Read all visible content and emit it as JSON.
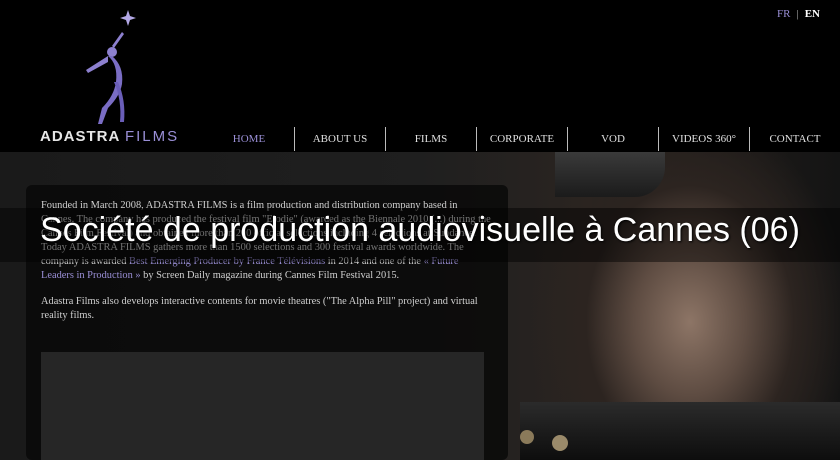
{
  "header": {
    "logo_primary": "ADASTRA",
    "logo_secondary": "FILMS",
    "lang_fr": "FR",
    "lang_separator": "|",
    "lang_en": "EN"
  },
  "nav": {
    "items": [
      "HOME",
      "ABOUT US",
      "FILMS",
      "CORPORATE",
      "VOD",
      "VIDEOS 360°",
      "CONTACT"
    ]
  },
  "content": {
    "para1_part1": "Founded in March 2008, ADASTRA FILMS is a film production and distribution company based in Cannes. The company has produced the festival film \"Elodie\" (awarded as the Biennale 2010 (...) during the Cannes Film Festival) and obtained more than 200 official selections including 4 selections at Sundance. Today ADASTRA FILMS gathers more than 1500 selections and 300 festival awards worldwide. The company is awarded ",
    "para1_link1": "Best Emerging Producer by France Télévisions",
    "para1_part2": " in 2014 and one of the ",
    "para1_link2": "« Future Leaders in Production »",
    "para1_part3": " by Screen Daily magazine during Cannes Film Festival 2015.",
    "para2": "Adastra Films also develops interactive contents for movie theatres (\"The Alpha Pill\" project) and virtual reality films."
  },
  "banner": {
    "title": "Société de production audiovisuelle à Cannes (06)"
  },
  "colors": {
    "accent": "#9a8fd6",
    "background": "#000000",
    "text": "#cfcfcf"
  }
}
